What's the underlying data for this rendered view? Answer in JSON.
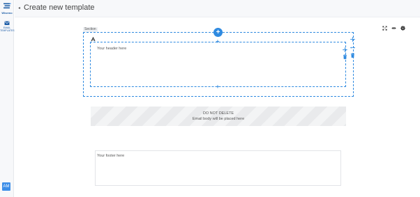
{
  "sidebar": {
    "logo_text": "Wisemo",
    "nav_label": "EMAIL TEMPLATES",
    "avatar_initials": "AM"
  },
  "header": {
    "back_arrow": "◂",
    "title": "Create new template"
  },
  "section": {
    "label": "Section",
    "header_placeholder": "Your header here",
    "add_symbol": "+"
  },
  "body_placeholder": {
    "line1": "DO NOT DELETE",
    "line2": "Email body will be placed here"
  },
  "footer": {
    "placeholder": "Your footer here"
  },
  "colors": {
    "accent": "#2f8ae0",
    "brand": "#1f5fa8"
  }
}
